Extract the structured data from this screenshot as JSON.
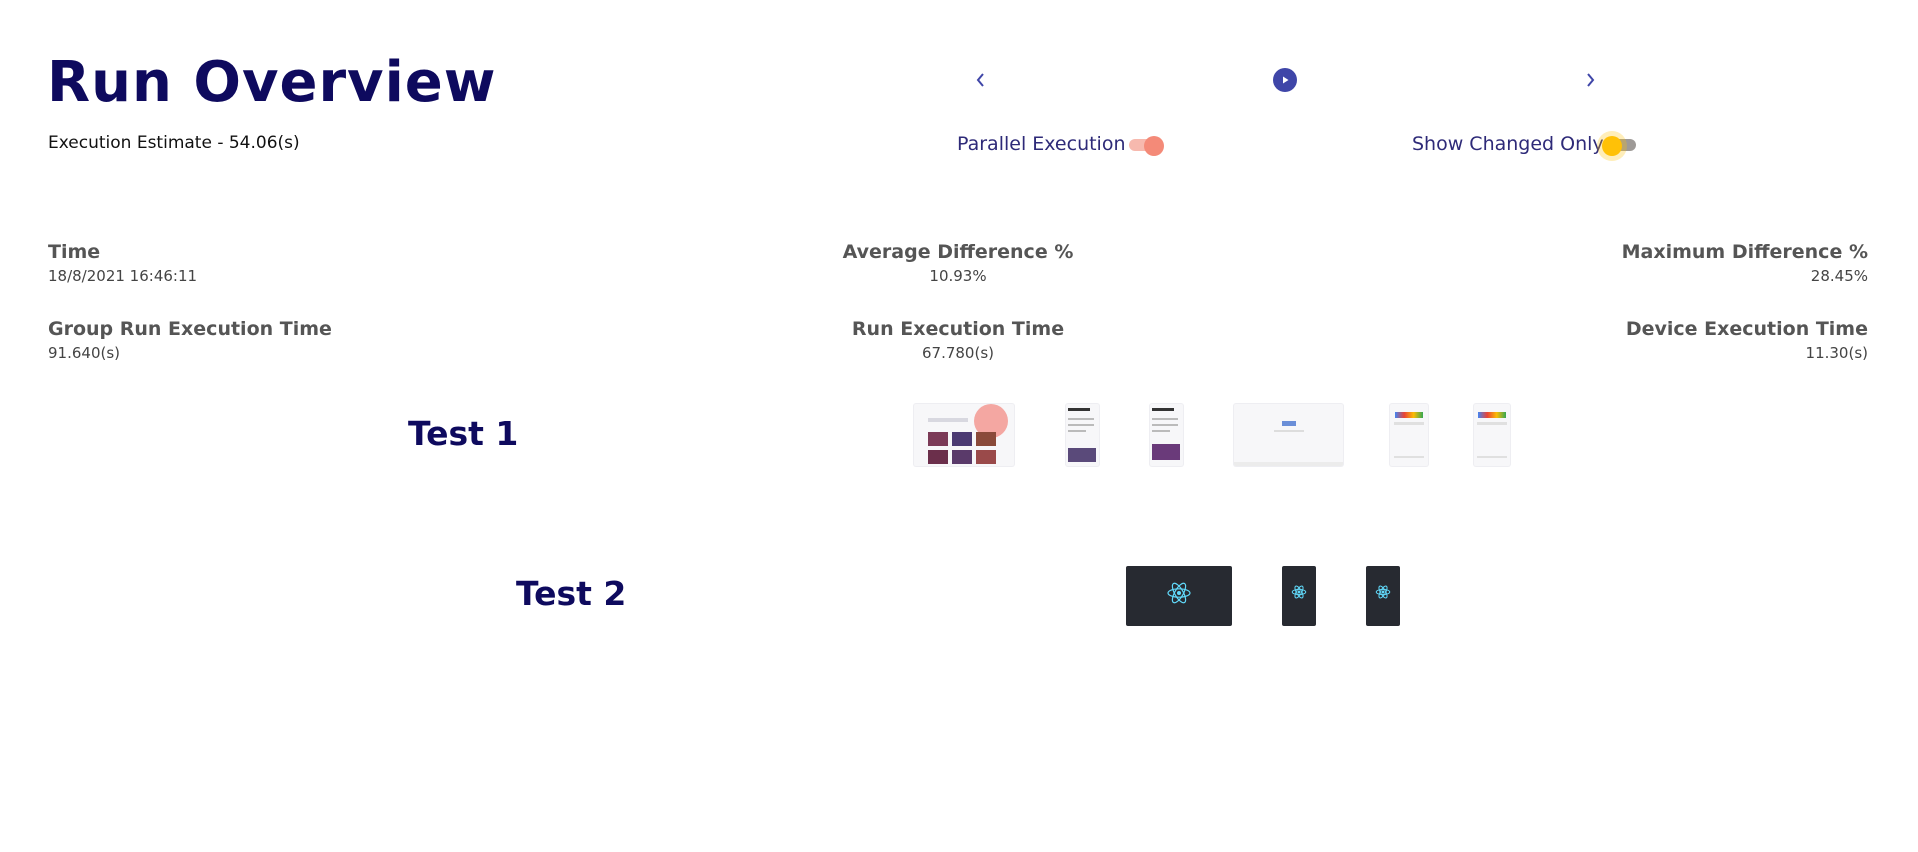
{
  "header": {
    "title": "Run Overview",
    "estimate": "Execution Estimate - 54.06(s)"
  },
  "controls": {
    "prev_icon": "chevron-left-icon",
    "play_icon": "play-circle-icon",
    "next_icon": "chevron-right-icon",
    "parallel_label": "Parallel Execution",
    "parallel_on": true,
    "changed_label": "Show Changed Only",
    "changed_on": false,
    "colors": {
      "accent": "#3f46a8",
      "parallel_knob": "#f48a78",
      "parallel_track": "#f7b9ae",
      "changed_knob": "#ffc107",
      "changed_track": "#9e9a97"
    }
  },
  "stats": {
    "time_label": "Time",
    "time_value": "18/8/2021 16:46:11",
    "avg_label": "Average Difference %",
    "avg_value": "10.93%",
    "max_label": "Maximum Difference %",
    "max_value": "28.45%",
    "group_label": "Group Run Execution Time",
    "group_value": "91.640(s)",
    "run_label": "Run Execution Time",
    "run_value": "67.780(s)",
    "device_label": "Device Execution Time",
    "device_value": "11.30(s)"
  },
  "tests": [
    {
      "title": "Test 1"
    },
    {
      "title": "Test 2"
    }
  ],
  "theme": {
    "title_color": "#0e0a5e"
  }
}
